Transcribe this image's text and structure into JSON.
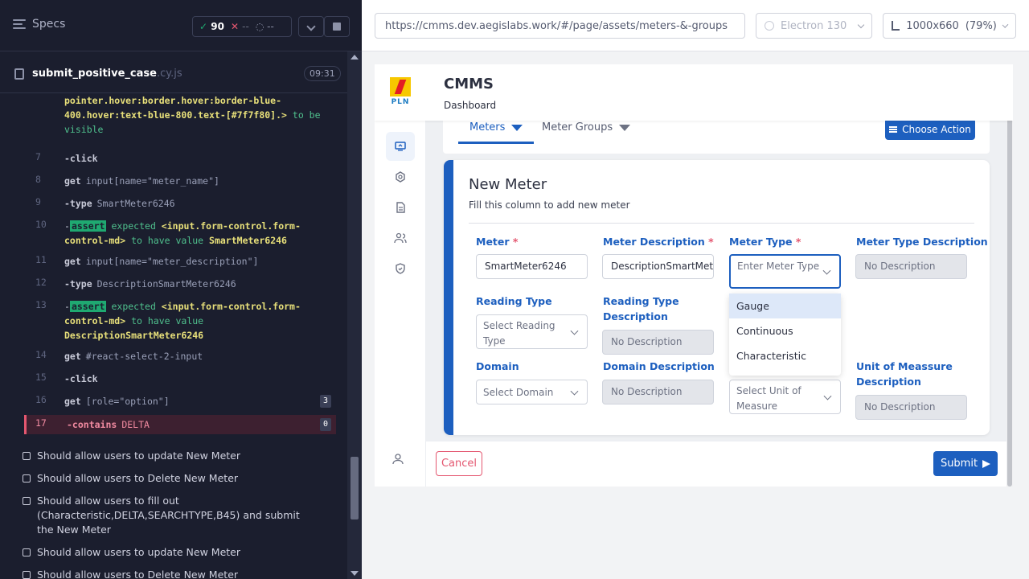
{
  "runner": {
    "specs_label": "Specs",
    "stats": {
      "passed": "90",
      "failed": "--",
      "pending": "--"
    },
    "file": {
      "name": "submit_positive_case",
      "ext": ".cy.js",
      "time": "09:31"
    },
    "commands": [
      {
        "num": "",
        "text": "pointer.hover:border.hover:border-blue-400.hover:text-blue-800.text-[#7f7f80].> to be visible"
      },
      {
        "num": "7",
        "name": "-click",
        "value": ""
      },
      {
        "num": "8",
        "name": "get",
        "value": "input[name=\"meter_name\"]"
      },
      {
        "num": "9",
        "name": "-type",
        "value": "SmartMeter6246"
      },
      {
        "num": "10",
        "tag": "assert",
        "text": "expected <input.form-control.form-control-md> to have value SmartMeter6246"
      },
      {
        "num": "11",
        "name": "get",
        "value": "input[name=\"meter_description\"]"
      },
      {
        "num": "12",
        "name": "-type",
        "value": "DescriptionSmartMeter6246"
      },
      {
        "num": "13",
        "tag": "assert",
        "text": "expected <input.form-control.form-control-md> to have value DescriptionSmartMeter6246"
      },
      {
        "num": "14",
        "name": "get",
        "value": "#react-select-2-input"
      },
      {
        "num": "15",
        "name": "-click",
        "value": ""
      },
      {
        "num": "16",
        "name": "get",
        "value": "[role=\"option\"]",
        "count": "3"
      },
      {
        "num": "17",
        "name": "-contains",
        "value": "DELTA",
        "count": "0"
      }
    ],
    "tests": [
      "Should allow users to update New Meter",
      "Should allow users to Delete New Meter",
      "Should allow users to fill out (Characteristic,DELTA,SEARCHTYPE,B45) and submit the New Meter",
      "Should allow users to update New Meter",
      "Should allow users to Delete New Meter"
    ]
  },
  "aut": {
    "url": "https://cmms.dev.aegislabs.work/#/page/assets/meters-&-groups",
    "browser": "Electron 130",
    "viewport": "1000x660",
    "zoom": "(79%)"
  },
  "app": {
    "brand": "PLN",
    "title": "CMMS",
    "subtitle": "Dashboard",
    "tabs": [
      "Meters",
      "Meter Groups"
    ],
    "choose_action": "Choose Action",
    "card": {
      "title": "New Meter",
      "subtitle": "Fill this column to add new meter",
      "fields": {
        "meter": {
          "label": "Meter",
          "value": "SmartMeter6246"
        },
        "meter_description": {
          "label": "Meter Description",
          "value": "DescriptionSmartMet"
        },
        "meter_type": {
          "label": "Meter Type",
          "placeholder": "Enter Meter Type"
        },
        "meter_type_description": {
          "label": "Meter Type Description",
          "value": "No Description"
        },
        "reading_type": {
          "label": "Reading Type",
          "placeholder": "Select Reading Type"
        },
        "reading_type_description": {
          "label": "Reading Type Description",
          "value": "No Description"
        },
        "domain": {
          "label": "Domain",
          "placeholder": "Select Domain"
        },
        "domain_description": {
          "label": "Domain Description",
          "value": "No Description"
        },
        "uom": {
          "placeholder": "Select Unit of Measure"
        },
        "uom_description": {
          "label": "Unit of Meassure Description",
          "value": "No Description"
        }
      },
      "meter_type_options": [
        "Gauge",
        "Continuous",
        "Characteristic"
      ]
    },
    "cancel": "Cancel",
    "submit": "Submit"
  },
  "colors": {
    "primary": "#1d5fbf",
    "danger": "#e45770",
    "pass": "#1fa971"
  }
}
